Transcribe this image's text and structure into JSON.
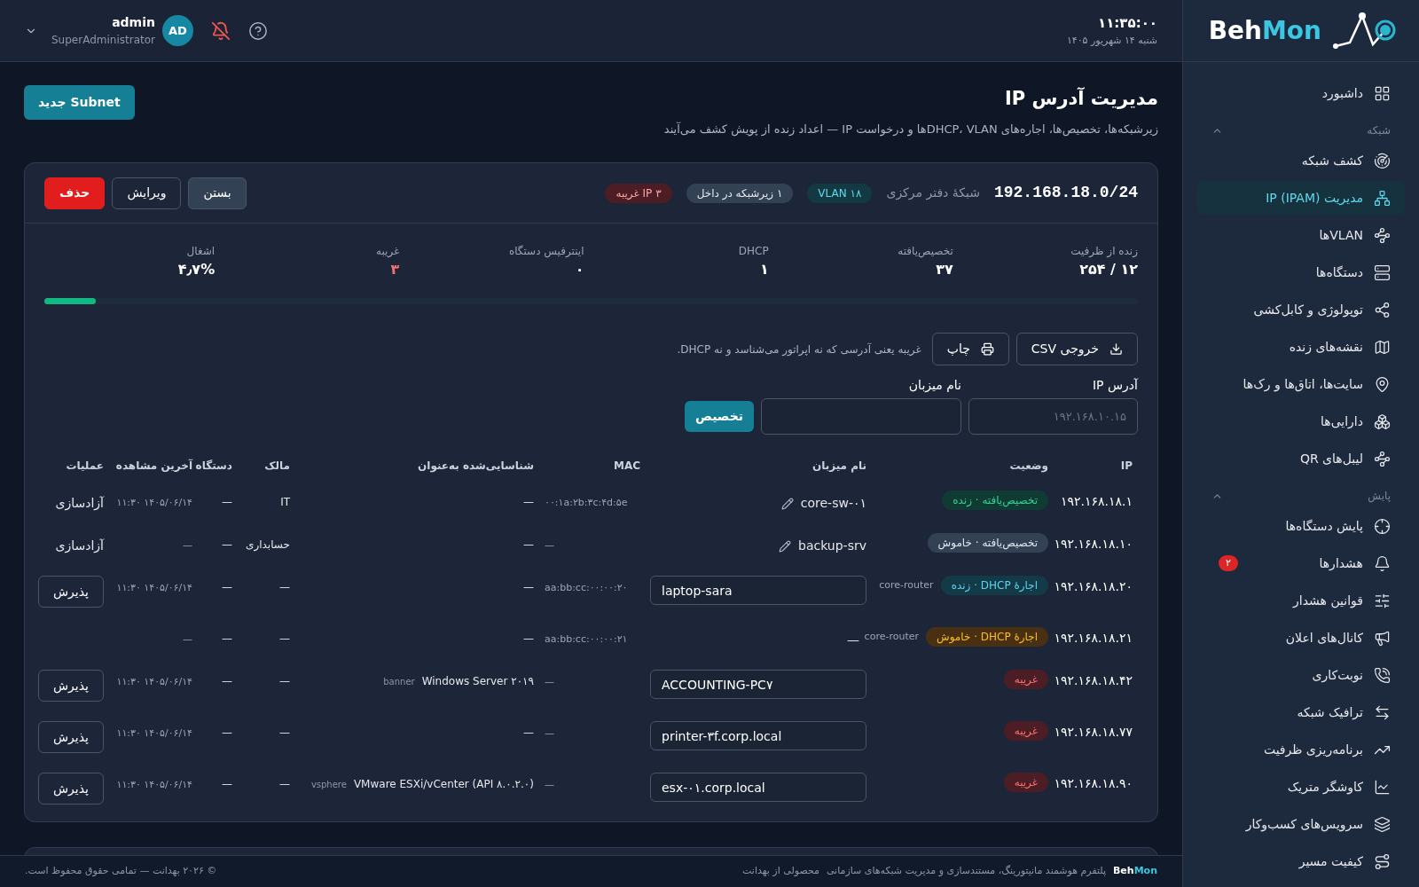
{
  "header": {
    "clock": "۱۱:۳۵:۰۰",
    "date": "شنبه ۱۴ شهریور ۱۴۰۵",
    "user": {
      "name": "admin",
      "role": "SuperAdministrator",
      "initials": "AD"
    }
  },
  "sidebar": {
    "logo": {
      "part1": "Beh",
      "part2": "Mon"
    },
    "items": [
      {
        "label": "داشبورد",
        "selected": false
      }
    ],
    "sections": [
      {
        "title": "شبکه",
        "expanded": true,
        "items": [
          {
            "label": "کشف شبکه",
            "selected": false
          },
          {
            "label": "مدیریت IP (IPAM)",
            "selected": true
          },
          {
            "label": "VLANها",
            "selected": false
          },
          {
            "label": "دستگاه‌ها",
            "selected": false
          },
          {
            "label": "توپولوژی و کابل‌کشی",
            "selected": false
          },
          {
            "label": "نقشه‌های زنده",
            "selected": false
          },
          {
            "label": "سایت‌ها، اتاق‌ها و رک‌ها",
            "selected": false
          },
          {
            "label": "دارایی‌ها",
            "selected": false
          },
          {
            "label": "لیبل‌های QR",
            "selected": false
          }
        ]
      },
      {
        "title": "پایش",
        "expanded": true,
        "items": [
          {
            "label": "پایش دستگاه‌ها",
            "selected": false
          },
          {
            "label": "هشدارها",
            "selected": false,
            "badge": "۲"
          },
          {
            "label": "قوانین هشدار",
            "selected": false
          },
          {
            "label": "کانال‌های اعلان",
            "selected": false
          },
          {
            "label": "نوبت‌کاری",
            "selected": false
          },
          {
            "label": "ترافیک شبکه",
            "selected": false
          },
          {
            "label": "برنامه‌ریزی ظرفیت",
            "selected": false
          },
          {
            "label": "کاوشگر متریک",
            "selected": false
          },
          {
            "label": "سرویس‌های کسب‌وکار",
            "selected": false
          },
          {
            "label": "کیفیت مسیر",
            "selected": false
          }
        ]
      }
    ]
  },
  "page": {
    "title": "مدیریت آدرس IP",
    "subtitle": "زیرشبکه‌ها، تخصیص‌ها، اجاره‌های DHCP، VLANها و درخواست IP — اعداد زنده از پویش کشف می‌آیند",
    "new_button": "Subnet جدید"
  },
  "subnet": {
    "cidr": "192.168.18.0/24",
    "name": "شبکهٔ دفتر مرکزی",
    "badges": [
      {
        "label": "VLAN ۱۸",
        "kind": "vlan"
      },
      {
        "label": "۱ زیرشبکه در داخل",
        "kind": "info"
      },
      {
        "label": "۳ IP غریبه",
        "kind": "alert"
      }
    ],
    "buttons": [
      {
        "label": "بستن",
        "kind": "secondary"
      },
      {
        "label": "ویرایش",
        "kind": "outline"
      },
      {
        "label": "حذف",
        "kind": "danger"
      }
    ],
    "stats": [
      {
        "label": "زنده از ظرفیت",
        "value": "۱۲ / ۲۵۴",
        "kind": "normal"
      },
      {
        "label": "تخصیص‌یافته",
        "value": "۳۷",
        "kind": "normal"
      },
      {
        "label": "DHCP",
        "value": "۱",
        "kind": "normal"
      },
      {
        "label": "اینترفیس دستگاه",
        "value": "۰",
        "kind": "normal"
      },
      {
        "label": "غریبه",
        "value": "۳",
        "kind": "alert"
      },
      {
        "label": "اشغال",
        "value": "۴٫۷%",
        "kind": "normal"
      }
    ],
    "occupancy": {
      "level": 0.047
    },
    "actions": [
      {
        "label": "خروجی CSV",
        "kind": "download"
      },
      {
        "label": "چاپ",
        "kind": "print"
      }
    ],
    "note": "غریبه یعنی آدرسی که نه اپراتور می‌شناسد و نه DHCP.",
    "form": {
      "ip_label": "آدرس IP",
      "ip_placeholder": "۱۹۲.۱۶۸.۱۰.۱۵",
      "host_label": "نام میزبان",
      "submit": "تخصیص"
    },
    "columns": [
      "IP",
      "وضعیت",
      "نام میزبان",
      "MAC",
      "شناسایی‌شده به‌عنوان",
      "مالک",
      "دستگاه",
      "آخرین مشاهده",
      "عملیات"
    ],
    "rows": [
      {
        "ip": "۱۹۲.۱۶۸.۱۸.۱",
        "status": {
          "label": "تخصیص‌یافته · زنده",
          "kind": "live"
        },
        "host": {
          "kind": "label",
          "text": "core-sw-۰۱"
        },
        "mac": "۰۰:۱a:۲b:۳c:۴d:۵e",
        "identified": {
          "text": "—"
        },
        "owner": "IT",
        "device": "—",
        "last_seen": "۱۴۰۵/۰۶/۱۴ ۱۱:۳۰",
        "action": {
          "kind": "link",
          "label": "آزادسازی"
        }
      },
      {
        "ip": "۱۹۲.۱۶۸.۱۸.۱۰",
        "status": {
          "label": "تخصیص‌یافته · خاموش",
          "kind": "off"
        },
        "host": {
          "kind": "label",
          "text": "backup-srv"
        },
        "mac": "—",
        "identified": {
          "text": "—"
        },
        "owner": "حسابداری",
        "device": "—",
        "last_seen": "—",
        "action": {
          "kind": "link",
          "label": "آزادسازی"
        }
      },
      {
        "ip": "۱۹۲.۱۶۸.۱۸.۲۰",
        "status": {
          "label": "اجارهٔ DHCP · زنده",
          "kind": "lease_live"
        },
        "source": "core-router",
        "host": {
          "kind": "input",
          "text": "laptop-sara"
        },
        "mac": "aa:bb:cc:۰۰:۰۰:۲۰",
        "identified": {
          "text": "—"
        },
        "owner": "—",
        "device": "—",
        "last_seen": "۱۴۰۵/۰۶/۱۴ ۱۱:۳۰",
        "action": {
          "kind": "button",
          "label": "پذیرش"
        }
      },
      {
        "ip": "۱۹۲.۱۶۸.۱۸.۲۱",
        "status": {
          "label": "اجارهٔ DHCP · خاموش",
          "kind": "lease_off"
        },
        "source": "core-router",
        "host": {
          "kind": "none",
          "text": "—"
        },
        "mac": "aa:bb:cc:۰۰:۰۰:۲۱",
        "identified": {
          "text": "—"
        },
        "owner": "—",
        "device": "—",
        "last_seen": "—"
      },
      {
        "ip": "۱۹۲.۱۶۸.۱۸.۴۲",
        "status": {
          "label": "غریبه",
          "kind": "rogue"
        },
        "host": {
          "kind": "input",
          "text": "ACCOUNTING-PC۷"
        },
        "mac": "—",
        "identified": {
          "text": "Windows Server ۲۰۱۹",
          "tag": "banner"
        },
        "owner": "—",
        "device": "—",
        "last_seen": "۱۴۰۵/۰۶/۱۴ ۱۱:۳۰",
        "action": {
          "kind": "button",
          "label": "پذیرش"
        }
      },
      {
        "ip": "۱۹۲.۱۶۸.۱۸.۷۷",
        "status": {
          "label": "غریبه",
          "kind": "rogue"
        },
        "host": {
          "kind": "input",
          "text": "printer-۳f.corp.local"
        },
        "mac": "—",
        "identified": {
          "text": "—"
        },
        "owner": "—",
        "device": "—",
        "last_seen": "۱۴۰۵/۰۶/۱۴ ۱۱:۳۰",
        "action": {
          "kind": "button",
          "label": "پذیرش"
        }
      },
      {
        "ip": "۱۹۲.۱۶۸.۱۸.۹۰",
        "status": {
          "label": "غریبه",
          "kind": "rogue"
        },
        "host": {
          "kind": "input",
          "text": "esx-۰۱.corp.local"
        },
        "mac": "—",
        "identified": {
          "text": "VMware ESXi/vCenter (API ۸.۰.۲.۰)",
          "tag": "vsphere"
        },
        "owner": "—",
        "device": "—",
        "last_seen": "۱۴۰۵/۰۶/۱۴ ۱۱:۳۰",
        "action": {
          "kind": "button",
          "label": "پذیرش"
        }
      }
    ]
  },
  "footer": {
    "brand": {
      "part1": "Beh",
      "part2": "Mon"
    },
    "tagline": "پلتفرم هوشمند مانیتورینگ، مستندسازی و مدیریت شبکه‌های سازمانی",
    "maker": "محصولی از بهدانت",
    "copyright": "© ۲۰۲۶ بهدانت — تمامی حقوق محفوظ است."
  }
}
